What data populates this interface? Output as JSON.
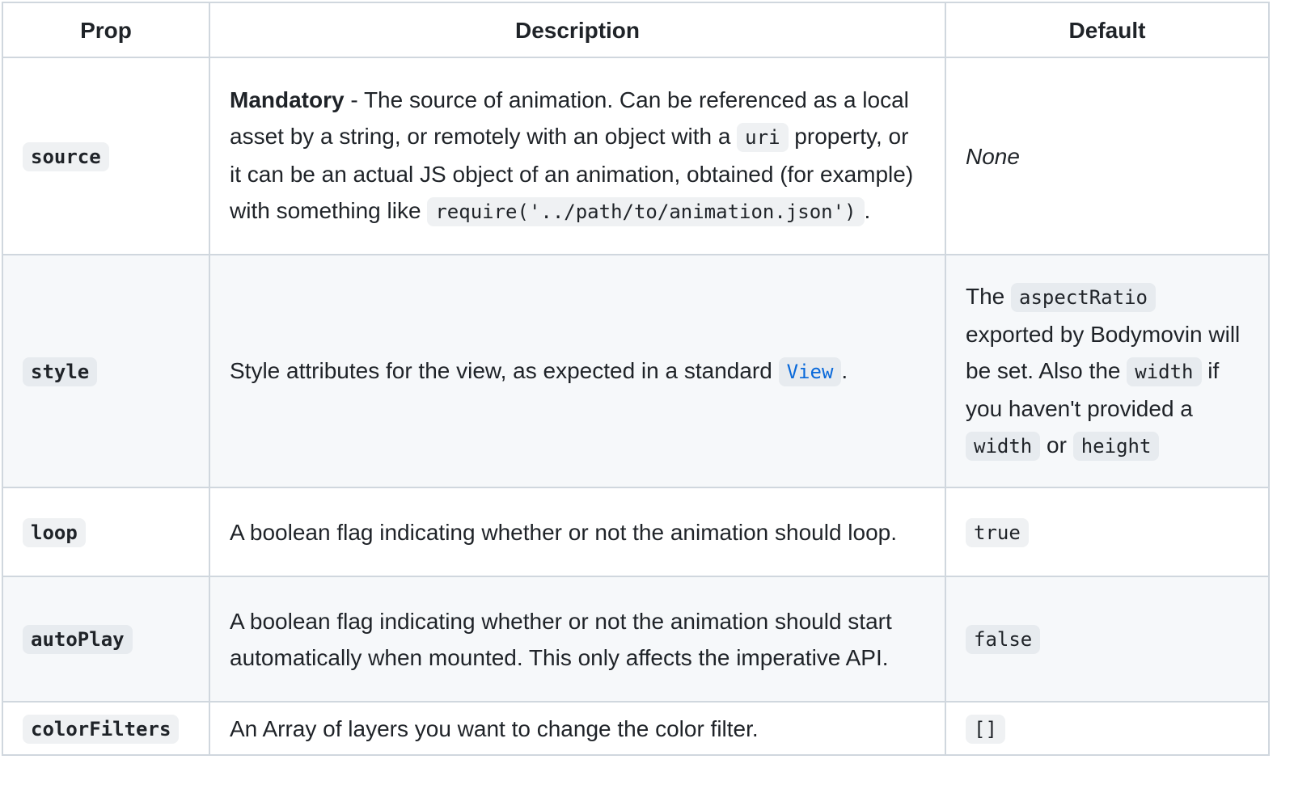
{
  "headers": {
    "prop": "Prop",
    "description": "Description",
    "default": "Default"
  },
  "rows": {
    "source": {
      "prop": "source",
      "desc_strong": "Mandatory",
      "desc_1": " - The source of animation. Can be referenced as a local asset by a string, or remotely with an object with a ",
      "desc_code_1": "uri",
      "desc_2": " property, or it can be an actual JS object of an animation, obtained (for example) with something like ",
      "desc_code_2": "require('../path/to/animation.json')",
      "desc_3": ".",
      "default": "None"
    },
    "style": {
      "prop": "style",
      "desc_1": "Style attributes for the view, as expected in a standard ",
      "desc_link": "View",
      "desc_2": ".",
      "default_1": "The ",
      "default_code_1": "aspectRatio",
      "default_2": " exported by Bodymovin will be set. Also the ",
      "default_code_2": "width",
      "default_3": " if you haven't provided a ",
      "default_code_3": "width",
      "default_4": " or ",
      "default_code_4": "height"
    },
    "loop": {
      "prop": "loop",
      "desc": "A boolean flag indicating whether or not the animation should loop.",
      "default": "true"
    },
    "autoPlay": {
      "prop": "autoPlay",
      "desc": "A boolean flag indicating whether or not the animation should start automatically when mounted. This only affects the imperative API.",
      "default": "false"
    },
    "colorFilters": {
      "prop": "colorFilters",
      "desc": "An Array of layers you want to change the color filter.",
      "default": "[]"
    }
  },
  "colors": {
    "border": "#d0d7de",
    "stripe": "#f6f8fa",
    "link": "#0969da",
    "text": "#1f2328"
  }
}
